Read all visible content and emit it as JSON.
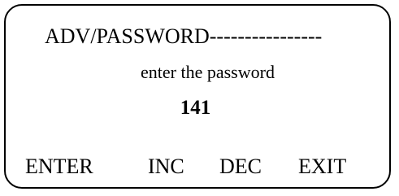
{
  "screen": {
    "title": "ADV/PASSWORD----------------",
    "prompt": "enter the password",
    "password_value": "141"
  },
  "softkeys": {
    "enter": "ENTER",
    "inc": "INC",
    "dec": "DEC",
    "exit": "EXIT"
  },
  "colors": {
    "background": "#ffffff",
    "foreground": "#000000"
  }
}
